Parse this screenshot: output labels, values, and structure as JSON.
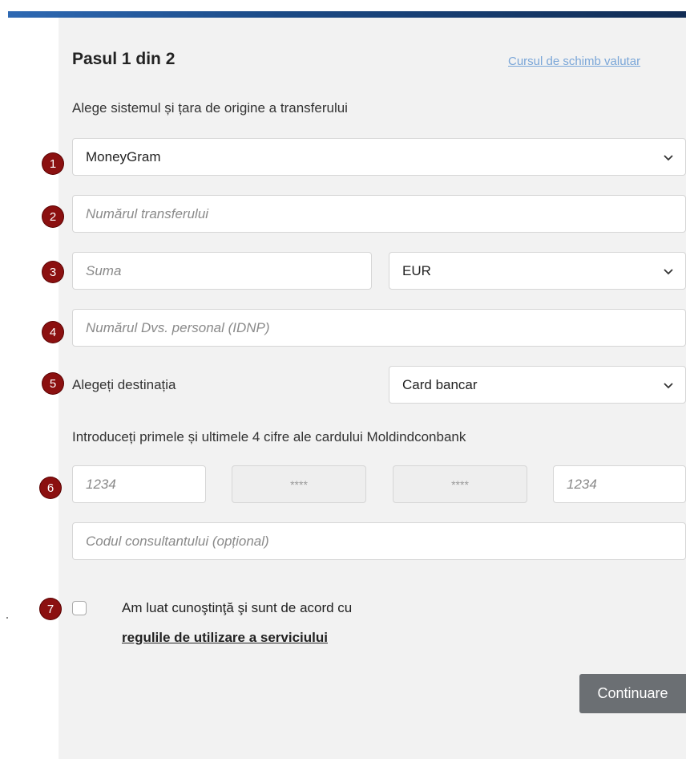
{
  "step": {
    "title": "Pasul 1 din 2",
    "rate_link": "Cursul de schimb valutar",
    "subtitle": "Alege sistemul și țara de origine a transferului"
  },
  "badges": [
    "1",
    "2",
    "3",
    "4",
    "5",
    "6",
    "7"
  ],
  "form": {
    "system_select": {
      "value": "MoneyGram",
      "icon": "chevron-down-icon"
    },
    "transfer_number": {
      "placeholder": "Numărul transferului"
    },
    "amount": {
      "placeholder": "Suma"
    },
    "currency_select": {
      "value": "EUR",
      "icon": "chevron-down-icon"
    },
    "idnp": {
      "placeholder": "Numărul Dvs. personal (IDNP)"
    },
    "destination_label": "Alegeți destinația",
    "destination_select": {
      "value": "Card bancar",
      "icon": "chevron-down-icon"
    },
    "card_instructions": "Introduceți primele și ultimele 4 cifre ale cardului Moldindconbank",
    "card_first": {
      "placeholder": "1234"
    },
    "card_mid1": {
      "value": "****"
    },
    "card_mid2": {
      "value": "****"
    },
    "card_last": {
      "placeholder": "1234"
    },
    "consultant_code": {
      "placeholder": "Codul consultantului (opțional)"
    },
    "agree_text": "Am luat cunoştinţă şi sunt de acord cu",
    "agree_link": "regulile de utilizare a serviciului",
    "continue_label": "Continuare"
  },
  "colors": {
    "badge": "#8b1010",
    "link": "#7aa6d8",
    "button": "#6b6f73",
    "panel": "#f2f2f2"
  }
}
